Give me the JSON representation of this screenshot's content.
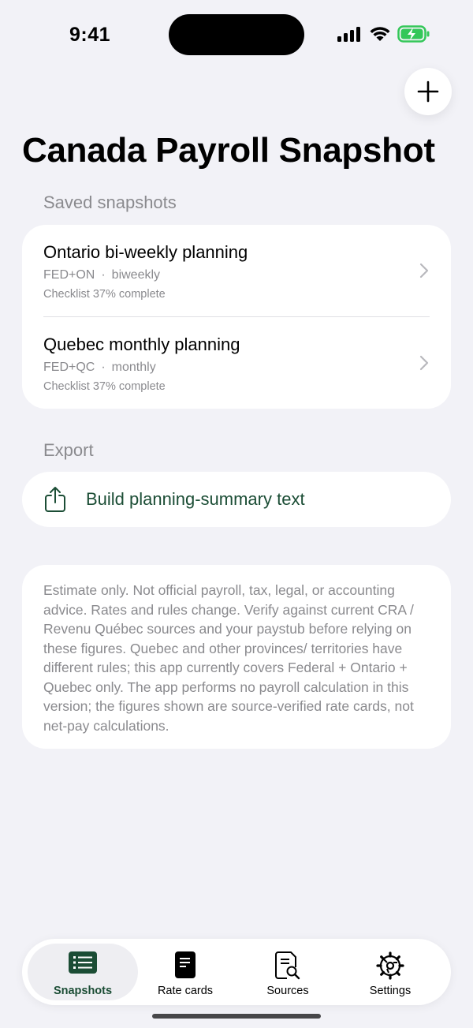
{
  "status_bar": {
    "time": "9:41"
  },
  "header": {
    "title": "Canada Payroll Snapshot"
  },
  "saved": {
    "section_label": "Saved snapshots",
    "items": [
      {
        "title": "Ontario bi-weekly planning",
        "jurisdiction": "FED+ON",
        "separator": "·",
        "frequency": "biweekly",
        "progress_text": "Checklist 37% complete"
      },
      {
        "title": "Quebec monthly planning",
        "jurisdiction": "FED+QC",
        "separator": "·",
        "frequency": "monthly",
        "progress_text": "Checklist 37% complete"
      }
    ]
  },
  "export": {
    "section_label": "Export",
    "button_label": "Build planning-summary text"
  },
  "disclaimer": {
    "text": "Estimate only. Not official payroll, tax, legal, or accounting advice. Rates and rules change. Verify against current CRA / Revenu Québec sources and your paystub before relying on these figures. Quebec and other provinces/ territories have different rules; this app currently covers Federal + Ontario + Quebec only. The app performs no payroll calculation in this version; the figures shown are source-verified rate cards, not net-pay calculations."
  },
  "tabs": [
    {
      "label": "Snapshots",
      "icon": "list-icon",
      "active": true
    },
    {
      "label": "Rate cards",
      "icon": "document-icon",
      "active": false
    },
    {
      "label": "Sources",
      "icon": "document-search-icon",
      "active": false
    },
    {
      "label": "Settings",
      "icon": "gear-icon",
      "active": false
    }
  ],
  "colors": {
    "accent": "#1b4d35",
    "background": "#f2f2f7",
    "battery": "#34c759"
  }
}
